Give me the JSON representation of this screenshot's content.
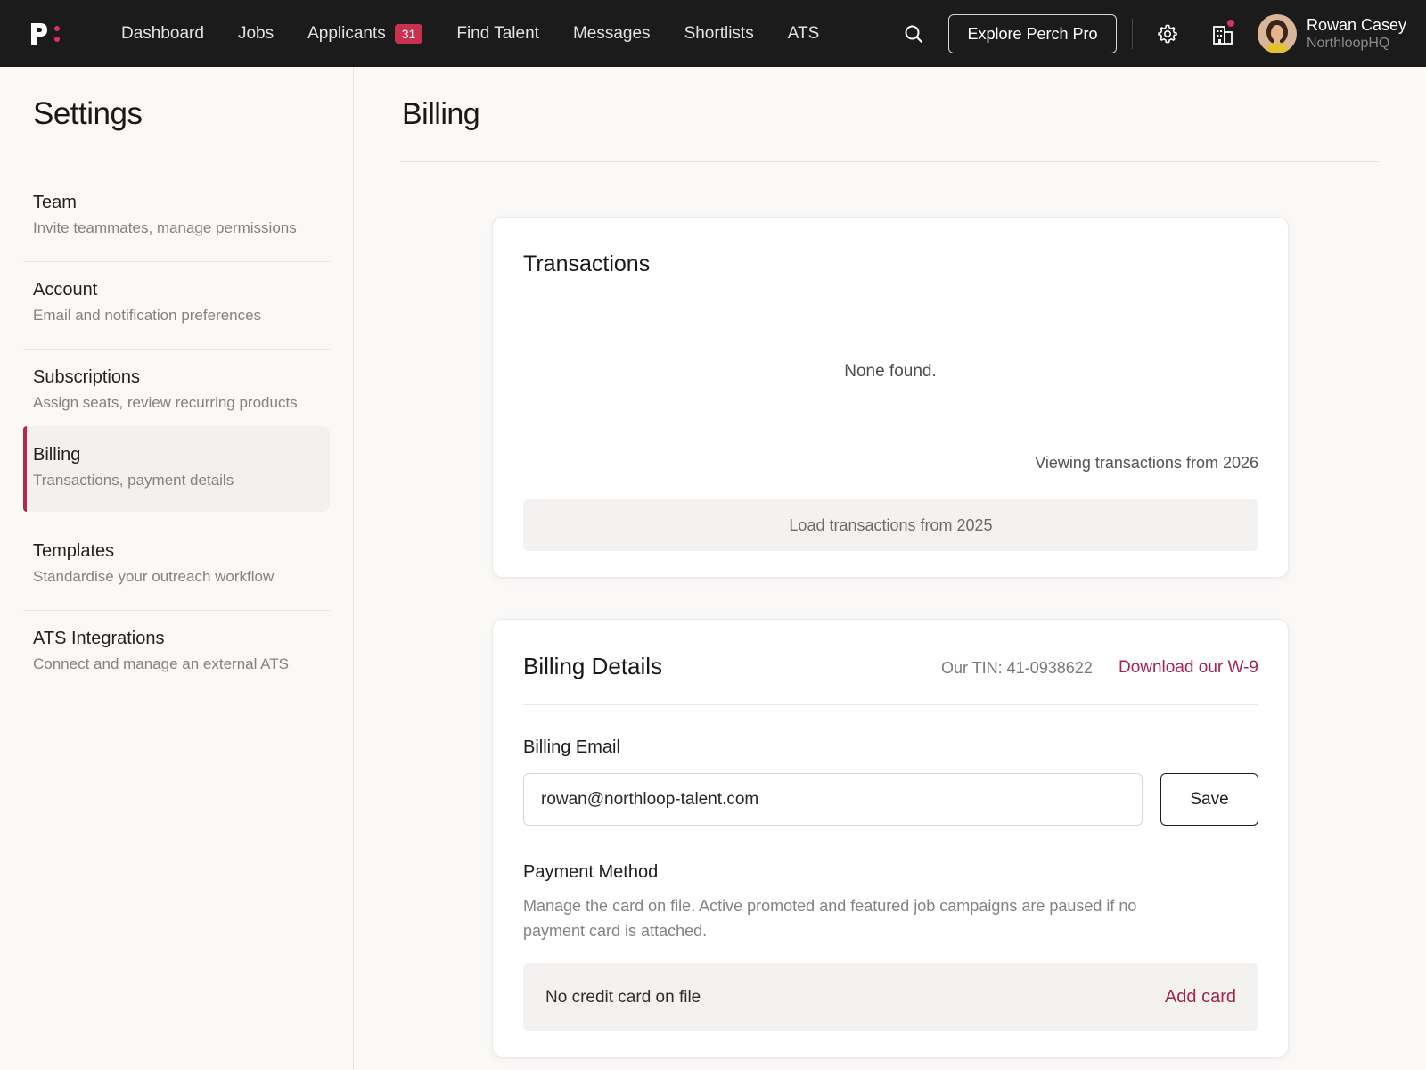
{
  "colors": {
    "nav_bg": "#1c1b1b",
    "accent": "#b5254d",
    "badge": "#c9314f",
    "link": "#a8244a"
  },
  "topnav": {
    "logo_icon": "perch-logo",
    "links": [
      {
        "label": "Dashboard"
      },
      {
        "label": "Jobs"
      },
      {
        "label": "Applicants",
        "badge": "31"
      },
      {
        "label": "Find Talent"
      },
      {
        "label": "Messages"
      },
      {
        "label": "Shortlists"
      },
      {
        "label": "ATS"
      }
    ],
    "search_icon": "search-icon",
    "pro_button": "Explore Perch Pro",
    "settings_icon": "gear-icon",
    "company_icon": "building-icon",
    "user": {
      "name": "Rowan Casey",
      "org": "NorthloopHQ"
    }
  },
  "sidebar": {
    "title": "Settings",
    "items": [
      {
        "label": "Team",
        "desc": "Invite teammates, manage permissions"
      },
      {
        "label": "Account",
        "desc": "Email and notification preferences"
      },
      {
        "label": "Subscriptions",
        "desc": "Assign seats, review recurring products"
      },
      {
        "label": "Billing",
        "desc": "Transactions, payment details",
        "active": true
      },
      {
        "label": "Templates",
        "desc": "Standardise your outreach workflow"
      },
      {
        "label": "ATS Integrations",
        "desc": "Connect and manage an external ATS"
      }
    ]
  },
  "main": {
    "title": "Billing",
    "transactions": {
      "title": "Transactions",
      "empty": "None found.",
      "viewing": "Viewing transactions from 2026",
      "load_button": "Load transactions from 2025"
    },
    "billing_details": {
      "title": "Billing Details",
      "tin": "Our TIN: 41-0938622",
      "w9_link": "Download our W-9",
      "email_label": "Billing Email",
      "email_value": "rowan@northloop-talent.com",
      "save_button": "Save",
      "payment_label": "Payment Method",
      "payment_desc": "Manage the card on file. Active promoted and featured job campaigns are paused if no payment card is attached.",
      "no_card": "No credit card on file",
      "add_card": "Add card"
    }
  }
}
